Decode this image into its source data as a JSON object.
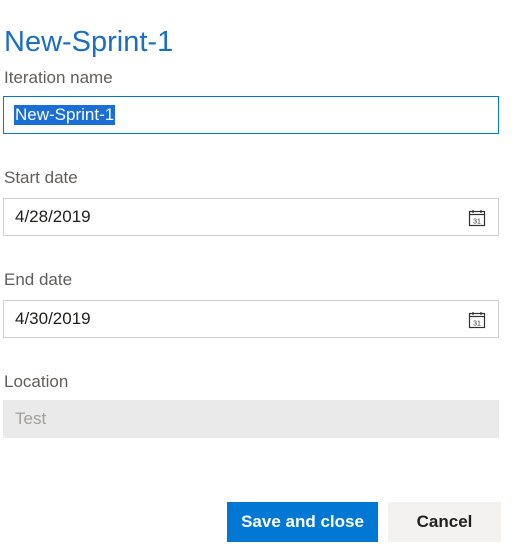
{
  "dialog": {
    "title": "New-Sprint-1"
  },
  "fields": {
    "iteration_name": {
      "label": "Iteration name",
      "value": "New-Sprint-1"
    },
    "start_date": {
      "label": "Start date",
      "value": "4/28/2019",
      "icon": "calendar-icon"
    },
    "end_date": {
      "label": "End date",
      "value": "4/30/2019",
      "icon": "calendar-icon"
    },
    "location": {
      "label": "Location",
      "value": "Test"
    }
  },
  "buttons": {
    "save_label": "Save and close",
    "cancel_label": "Cancel"
  },
  "calendar_day": "31",
  "colors": {
    "title": "#1a6fc4",
    "primary_button": "#0078d4",
    "focus_border": "#0078d4",
    "selection": "#1a6fd6",
    "disabled_field": "#eaeaea"
  }
}
